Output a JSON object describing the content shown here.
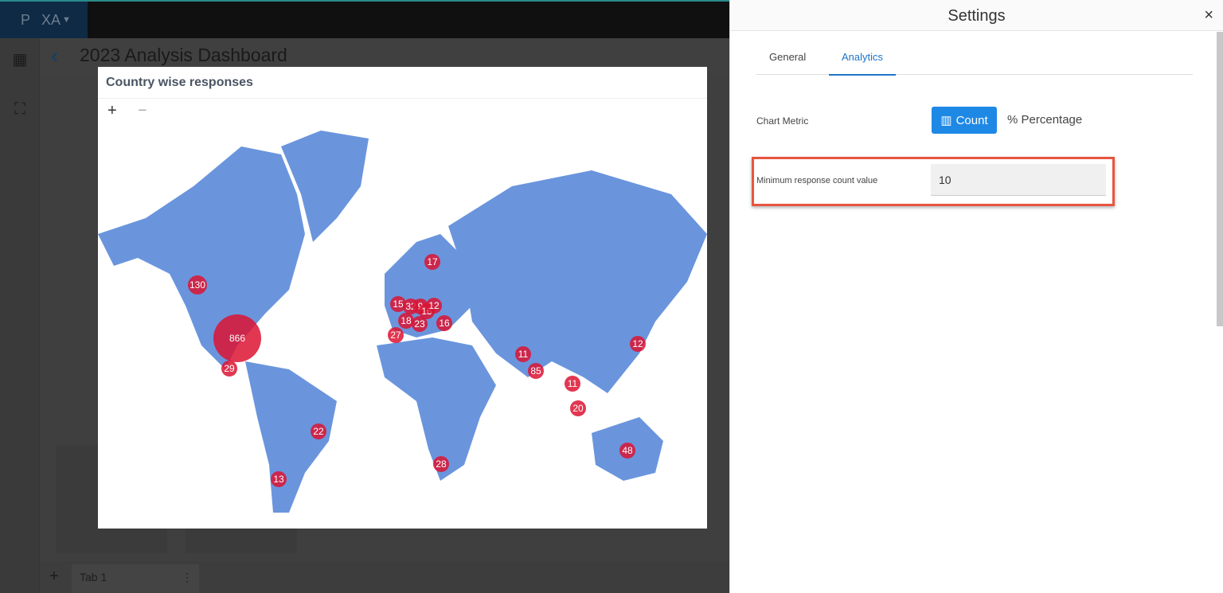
{
  "app": {
    "logo": "P",
    "workspace": "XA"
  },
  "dashboard": {
    "title": "2023 Analysis Dashboard",
    "tab": "Tab 1",
    "add_tab": "+"
  },
  "widget": {
    "title": "Country wise responses",
    "zoom_in": "+",
    "zoom_out": "−"
  },
  "chart_data": {
    "type": "bubble-map",
    "map_color": "#6a95dd",
    "bubble_color": "#dc1432",
    "values": [
      866,
      130,
      29,
      22,
      13,
      17,
      15,
      32,
      9,
      15,
      12,
      18,
      23,
      16,
      27,
      11,
      85,
      11,
      20,
      48,
      12,
      28
    ]
  },
  "settings": {
    "title": "Settings",
    "close": "×",
    "tabs": [
      {
        "label": "General"
      },
      {
        "label": "Analytics"
      }
    ],
    "chart_metric_label": "Chart Metric",
    "count_label": "Count",
    "percentage_label": "Percentage",
    "min_label": "Minimum response count value",
    "min_value": "10",
    "accent": "#1e88e5"
  }
}
